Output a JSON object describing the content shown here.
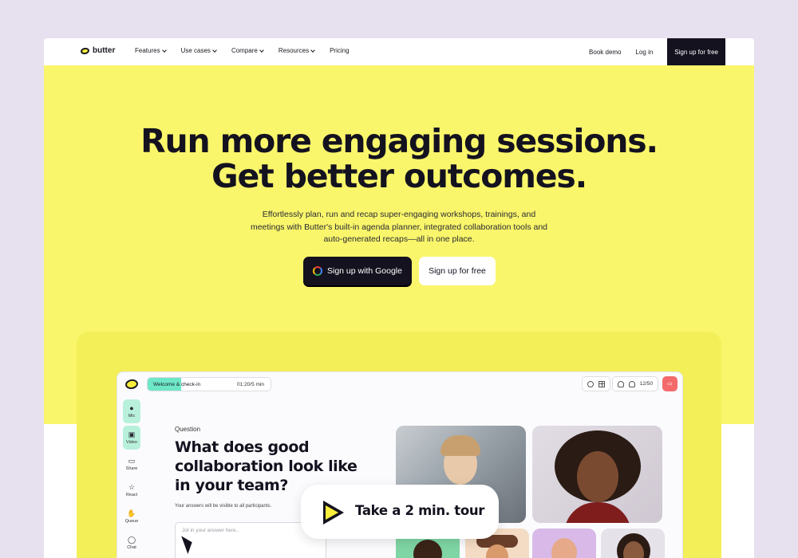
{
  "nav": {
    "brand": "butter",
    "menu": [
      "Features",
      "Use cases",
      "Compare",
      "Resources",
      "Pricing"
    ],
    "book_demo": "Book demo",
    "login": "Log in",
    "signup": "Sign up for free"
  },
  "hero": {
    "headline_line1": "Run more engaging sessions.",
    "headline_line2": "Get better outcomes.",
    "subtext": "Effortlessly plan, run and recap super-engaging workshops, trainings, and meetings with Butter's built-in agenda planner, integrated collaboration tools and auto-generated recaps—all in one place.",
    "cta_google": "Sign up with Google",
    "cta_free": "Sign up for free"
  },
  "app": {
    "agenda_item": "Welcome & check-in",
    "timer": "01:20/5 min",
    "timer_progress": 0.27,
    "participants": "12/50",
    "tools": [
      "Mic",
      "Video",
      "Share",
      "React",
      "Queue",
      "Chat"
    ],
    "question_label": "Question",
    "question": "What does good collaboration look like in your team?",
    "answer_note": "Your answers will be visible to all participants.",
    "answer_placeholder": "Jot in your answer here.."
  },
  "tour": {
    "label": "Take a 2 min. tour"
  },
  "colors": {
    "hero_bg": "#faf66b",
    "dark": "#14121f",
    "accent_green": "#6ee7c8",
    "leave": "#f36a6a"
  }
}
